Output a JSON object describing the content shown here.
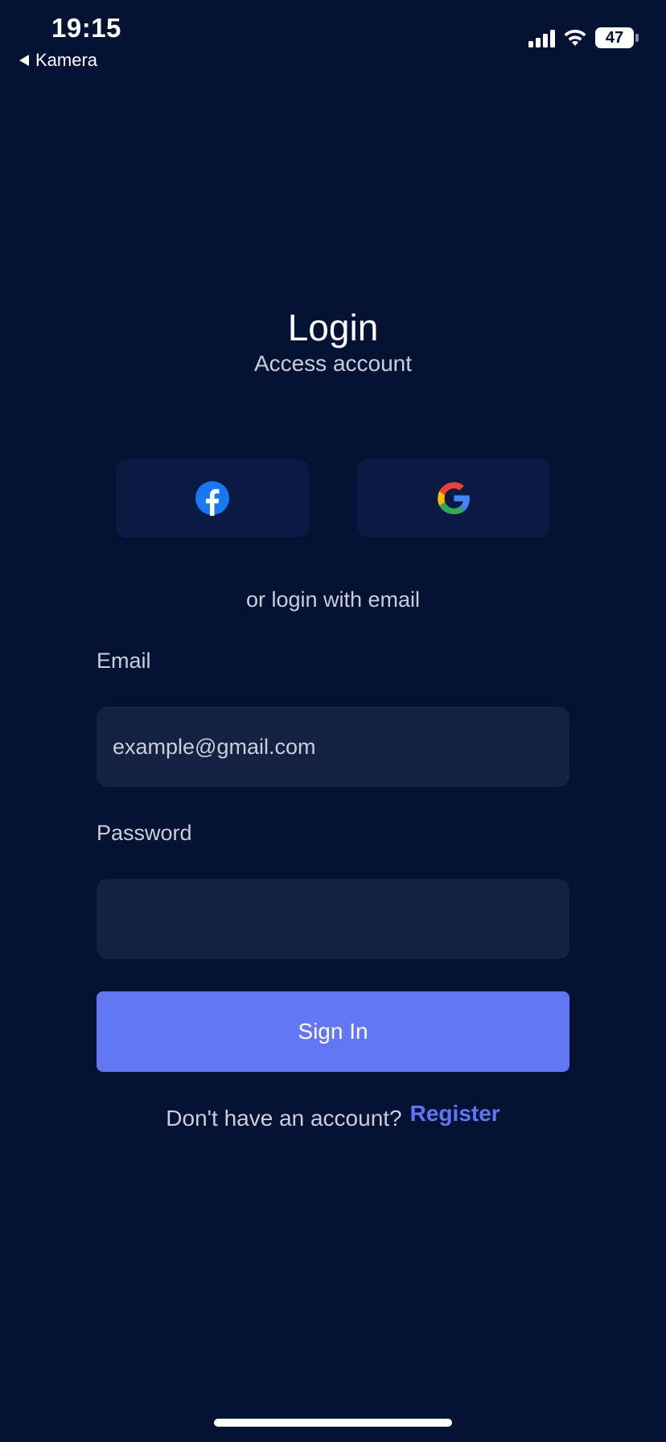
{
  "status_bar": {
    "time": "19:15",
    "back_label": "Kamera",
    "battery": "47"
  },
  "header": {
    "title": "Login",
    "subtitle": "Access account"
  },
  "social": {
    "facebook_icon": "facebook-icon",
    "google_icon": "google-icon"
  },
  "divider_text": "or login with email",
  "form": {
    "email_label": "Email",
    "email_placeholder": "example@gmail.com",
    "email_value": "",
    "password_label": "Password",
    "password_value": "",
    "submit_label": "Sign In"
  },
  "footer": {
    "prompt": "Don't have an account?",
    "register_label": "Register"
  },
  "colors": {
    "background": "#061233",
    "card": "#0b1a45",
    "input": "#152142",
    "accent": "#6376f4",
    "muted_text": "#c9cedb"
  }
}
